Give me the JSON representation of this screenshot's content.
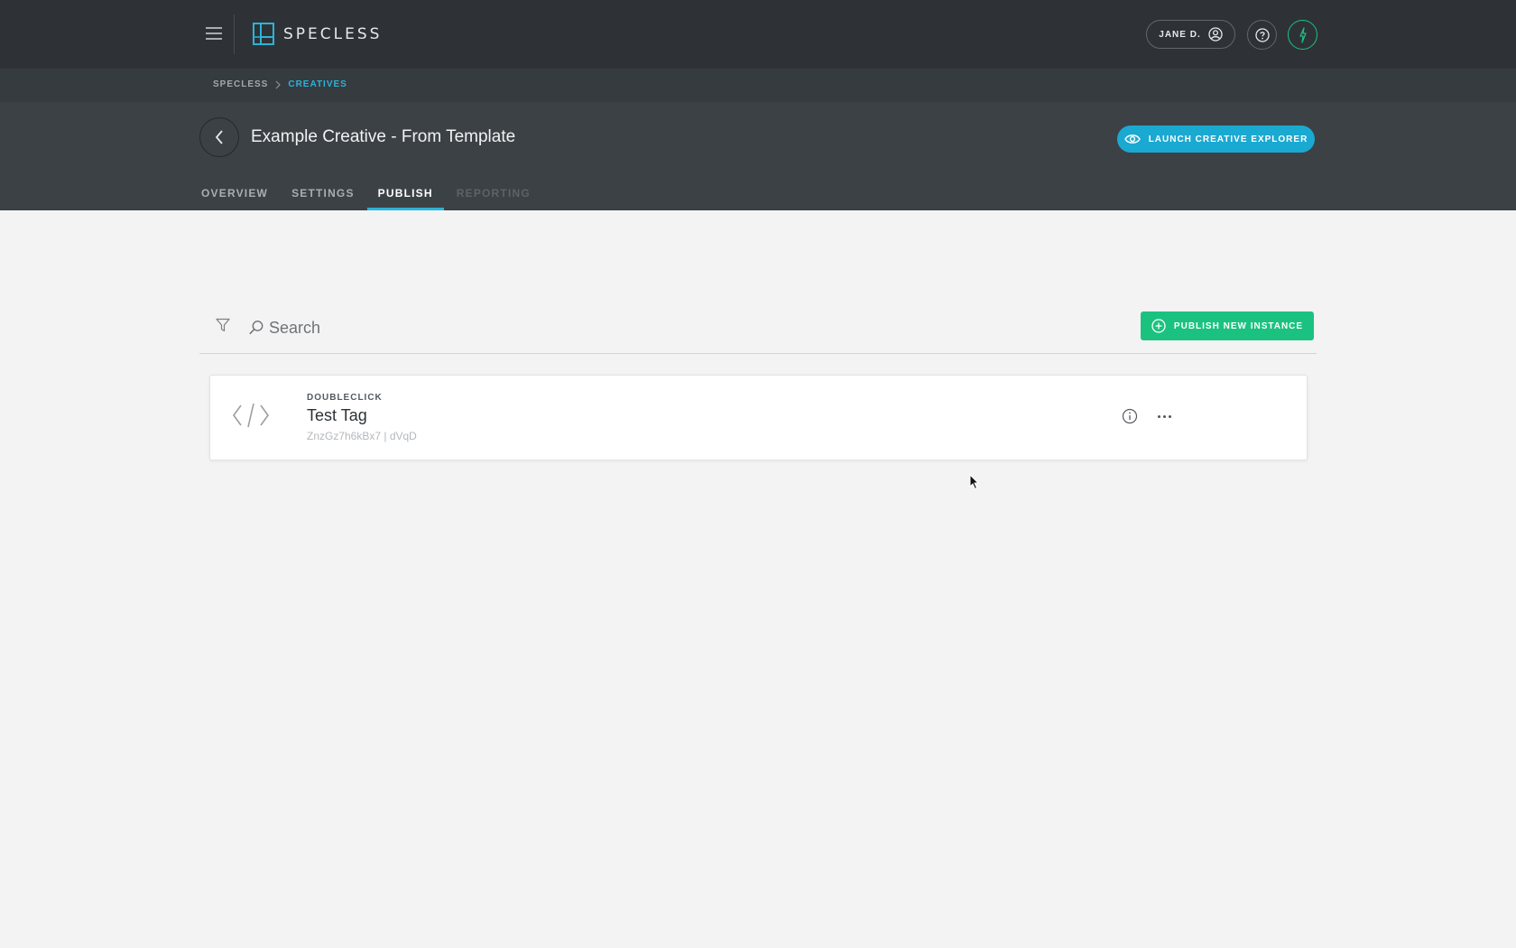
{
  "app": {
    "name": "SPECLESS",
    "user_label": "JANE D."
  },
  "breadcrumb": {
    "root": "SPECLESS",
    "current": "CREATIVES"
  },
  "header": {
    "title": "Example Creative - From Template",
    "launch_label": "LAUNCH CREATIVE EXPLORER"
  },
  "tabs": [
    {
      "label": "OVERVIEW",
      "state": "normal"
    },
    {
      "label": "SETTINGS",
      "state": "normal"
    },
    {
      "label": "PUBLISH",
      "state": "active"
    },
    {
      "label": "REPORTING",
      "state": "disabled"
    }
  ],
  "toolbar": {
    "search_placeholder": "Search",
    "publish_label": "PUBLISH NEW INSTANCE"
  },
  "instances": [
    {
      "provider": "DOUBLECLICK",
      "name": "Test Tag",
      "meta": "ZnzGz7h6kBx7 | dVqD",
      "icon": "code-icon"
    }
  ],
  "colors": {
    "topbar": "#2e3236",
    "header": "#3c4146",
    "accent_blue": "#1aa9d1",
    "accent_green": "#1bc27f",
    "background": "#f3f3f4"
  }
}
